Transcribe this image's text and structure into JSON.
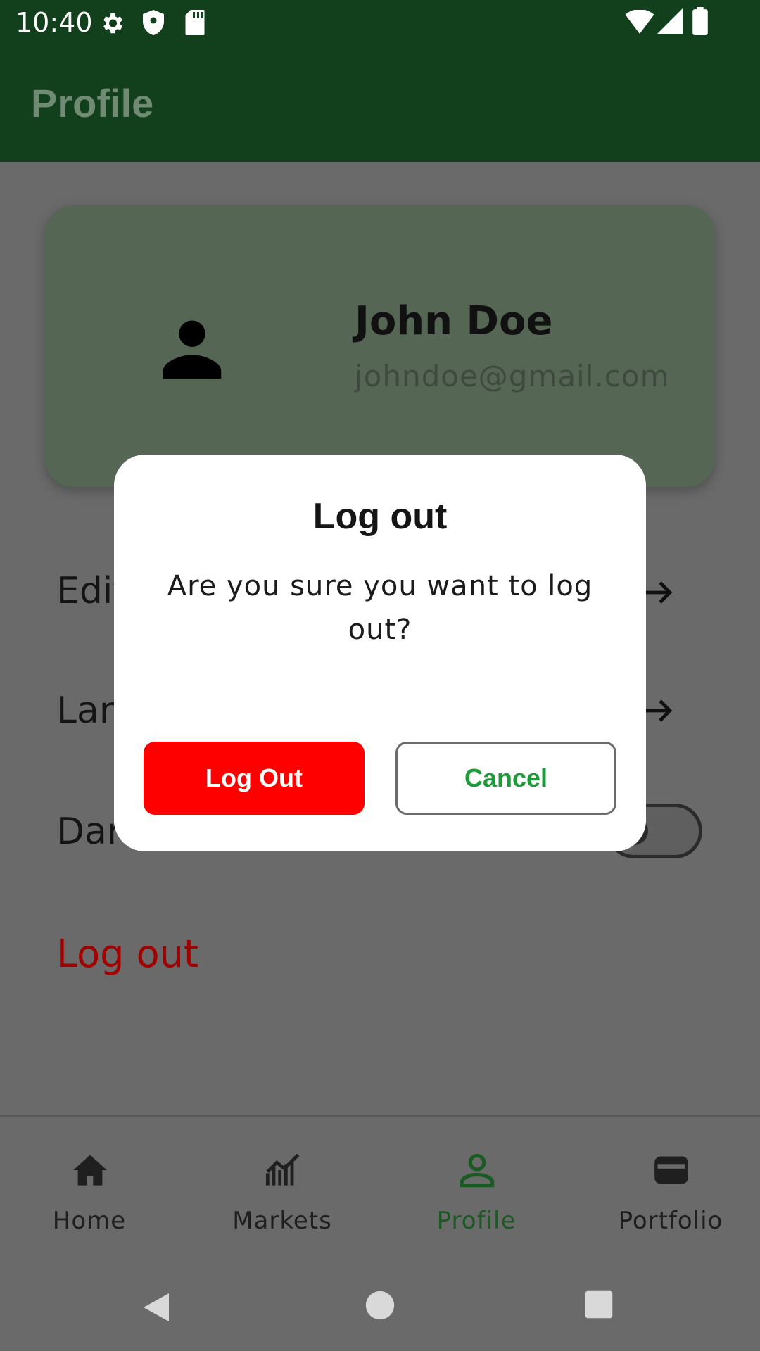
{
  "status_bar": {
    "time": "10:40",
    "left_icons": [
      "gear-icon",
      "shield-icon",
      "sd-card-icon"
    ],
    "right_icons": [
      "wifi-icon",
      "signal-icon",
      "battery-icon"
    ]
  },
  "app_bar": {
    "title": "Profile"
  },
  "profile_card": {
    "avatar_icon": "person-icon",
    "name": "John Doe",
    "email": "johndoe@gmail.com"
  },
  "menu": {
    "edit_label": "Edit",
    "language_label": "Lan",
    "dark_mode_label": "Dar",
    "logout_label": "Log out",
    "dark_mode_enabled": false
  },
  "dialog": {
    "title": "Log out",
    "message": "Are you sure you want to log out?",
    "confirm_label": "Log Out",
    "cancel_label": "Cancel"
  },
  "bottom_nav": {
    "items": [
      {
        "label": "Home",
        "icon": "home-icon"
      },
      {
        "label": "Markets",
        "icon": "chart-icon"
      },
      {
        "label": "Profile",
        "icon": "person-outline-icon",
        "active": true
      },
      {
        "label": "Portfolio",
        "icon": "wallet-icon"
      }
    ]
  },
  "colors": {
    "app_bar": "#12401c",
    "scrim": "#6a6a6a",
    "logout_button": "#ff0000",
    "cancel_text": "#1f9a3b",
    "active_nav": "#1c5a24",
    "logout_text": "#a10000"
  }
}
